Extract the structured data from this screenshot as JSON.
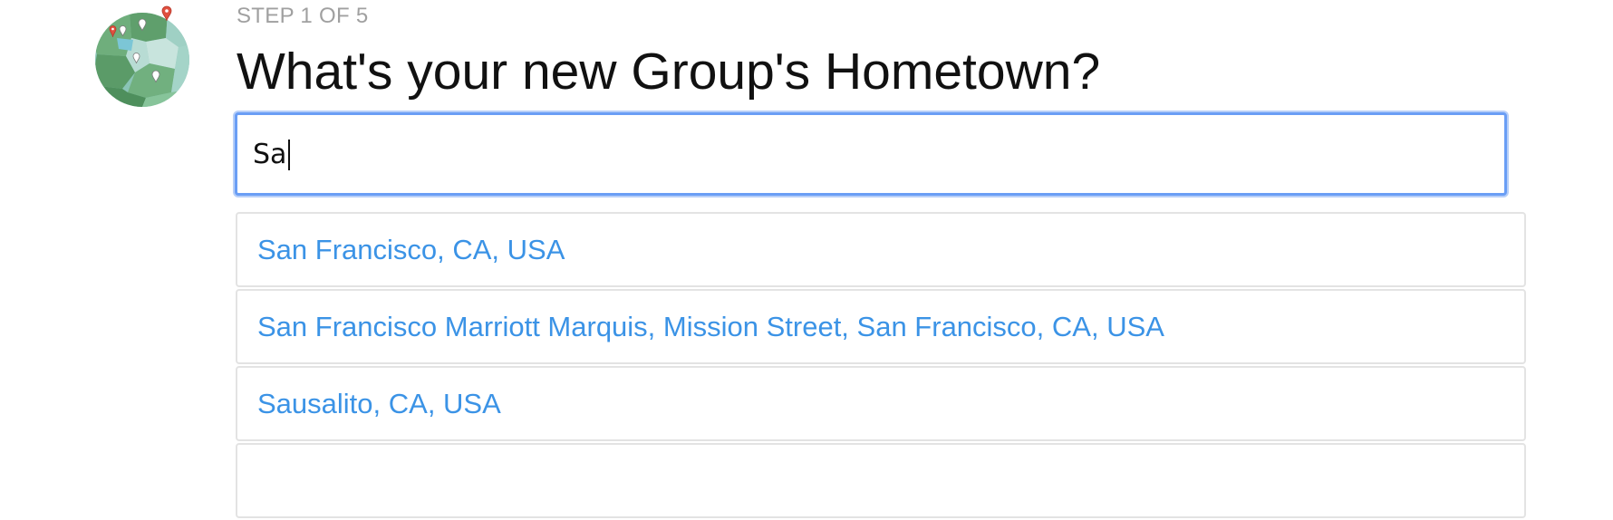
{
  "header": {
    "step_label": "STEP 1 OF 5",
    "title": "What's your new Group's Hometown?"
  },
  "search": {
    "value": "Sa"
  },
  "suggestions": [
    {
      "label": "San Francisco, CA, USA"
    },
    {
      "label": "San Francisco Marriott Marquis, Mission Street, San Francisco, CA, USA"
    },
    {
      "label": "Sausalito, CA, USA"
    },
    {
      "label": ""
    }
  ],
  "icons": {
    "globe": "globe-with-map-pins-icon"
  },
  "colors": {
    "accent_focus": "#6a9ef5",
    "link": "#3b93e6",
    "step_text": "#a0a0a0",
    "pin_red": "#e0503f"
  }
}
